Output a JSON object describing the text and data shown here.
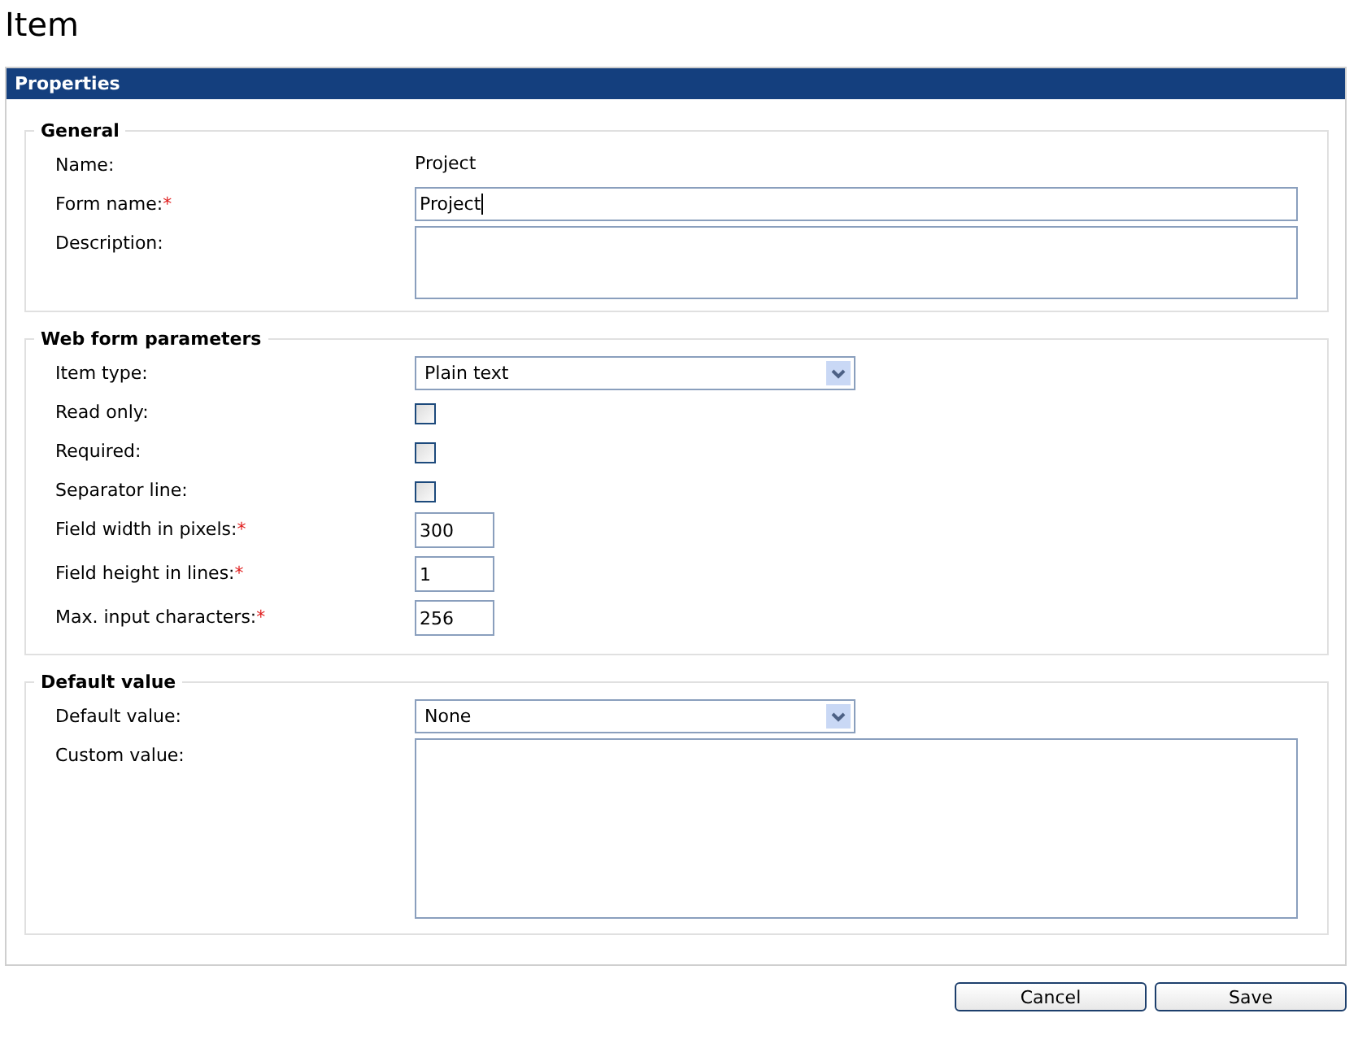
{
  "page_title": "Item",
  "panel": {
    "title": "Properties",
    "sections": [
      {
        "legend": "General",
        "fields": [
          {
            "kind": "text",
            "label": "Name:",
            "value": "Project"
          },
          {
            "kind": "input",
            "label": "Form name:",
            "mark": "*",
            "value": "Project",
            "focused": true
          },
          {
            "kind": "textarea",
            "label": "Description:"
          }
        ]
      },
      {
        "legend": "Web form parameters",
        "fields": [
          {
            "kind": "select",
            "label": "Item type:",
            "value": "Plain text"
          },
          {
            "kind": "checkbox",
            "label": "Read only:",
            "checked": false
          },
          {
            "kind": "checkbox",
            "label": "Required:",
            "checked": false
          },
          {
            "kind": "checkbox",
            "label": "Separator line:",
            "checked": false
          },
          {
            "kind": "small_input",
            "label": "Field width in pixels:",
            "mark": "*",
            "value": "300"
          },
          {
            "kind": "small_input",
            "label": "Field height in lines:",
            "mark": "*",
            "value": "1"
          },
          {
            "kind": "small_input",
            "label": "Max. input characters:",
            "mark": "*",
            "value": "256"
          }
        ]
      },
      {
        "legend": "Default value",
        "fields": [
          {
            "kind": "select",
            "label": "Default value:",
            "value": "None"
          },
          {
            "kind": "large_textarea",
            "label": "Custom value:"
          }
        ]
      }
    ]
  },
  "buttons": [
    "Cancel",
    "Save"
  ]
}
